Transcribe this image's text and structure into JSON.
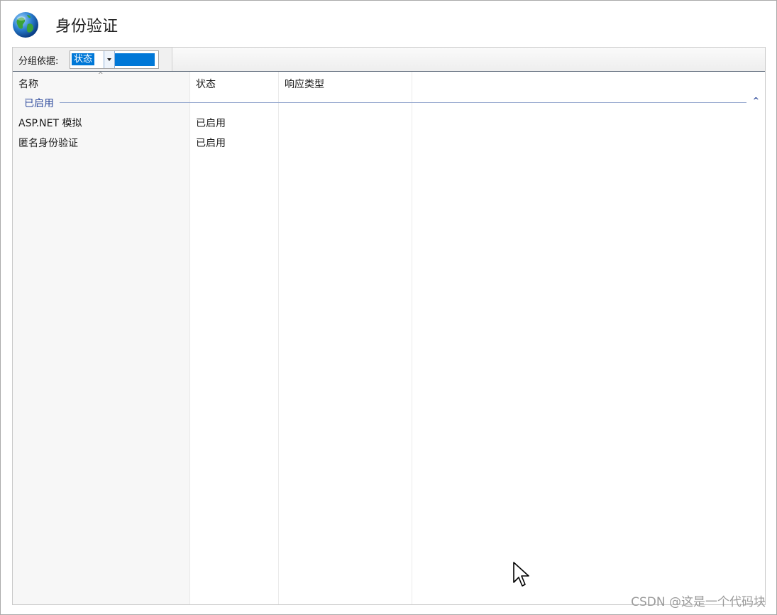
{
  "header": {
    "title": "身份验证",
    "icon": "globe-icon"
  },
  "toolbar": {
    "group_by_label": "分组依据:",
    "group_by_value": "状态"
  },
  "columns": [
    "名称",
    "状态",
    "响应类型"
  ],
  "group": {
    "label": "已启用"
  },
  "rows": [
    {
      "name": "ASP.NET 模拟",
      "status": "已启用",
      "response_type": ""
    },
    {
      "name": "匿名身份验证",
      "status": "已启用",
      "response_type": ""
    }
  ],
  "watermark": "CSDN @这是一个代码块",
  "colors": {
    "selection": "#0078d7",
    "group_text": "#2e4a9c"
  }
}
